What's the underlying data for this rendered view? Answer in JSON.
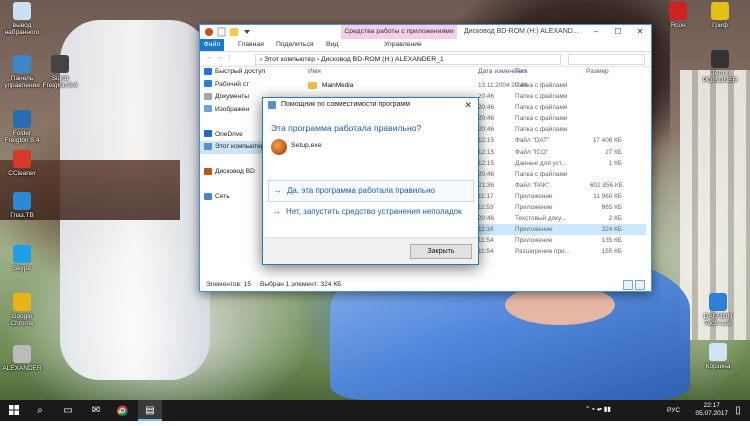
{
  "desktop": {
    "icons_left": [
      {
        "label": "вывод\nнабранного",
        "color": "#c8e0f0"
      },
      {
        "label": "Панель\nуправления",
        "color": "#3a86c8"
      },
      {
        "label": "Sigrid\nFreigton 8.4",
        "color": "#444444"
      },
      {
        "label": "Folder\nFreigton 8.4",
        "color": "#2b6cb0"
      },
      {
        "label": "CCleaner",
        "color": "#d43a2a"
      },
      {
        "label": "Глаз.ТВ",
        "color": "#2a8ad4"
      },
      {
        "label": "Skype",
        "color": "#1fa0e6"
      },
      {
        "label": "Google\nChrome",
        "color": "#e9b318"
      },
      {
        "label": "ALEXANDER",
        "color": "#bbbbbb"
      }
    ],
    "icons_right": [
      {
        "label": "Ясон",
        "color": "#d02020"
      },
      {
        "label": "Гриф",
        "color": "#e2c018"
      },
      {
        "label": "Terror\nPOISONER",
        "color": "#333333"
      },
      {
        "label": "DAEMON\nTools Lite",
        "color": "#2e7fd6"
      },
      {
        "label": "Корзина",
        "color": "#cfe4f5"
      }
    ]
  },
  "explorer": {
    "context_tab": "Средства работы с приложениями",
    "window_title": "Дисковод BD-ROM (H:) ALEXAND...",
    "ribbon_tabs": [
      "Файл",
      "Главная",
      "Поделиться",
      "Вид",
      "Управление"
    ],
    "breadcrumb": "›  Этот компьютер  ›  Дисковод BD-ROM (H:) ALEXANDER_1",
    "nav_items": [
      {
        "label": "Быстрый доступ",
        "color": "#1f78d1"
      },
      {
        "label": "Рабочий ст",
        "color": "#2b7cd3"
      },
      {
        "label": "Документы",
        "color": "#9aa9b6"
      },
      {
        "label": "Изображен",
        "color": "#6aa4d8"
      },
      {
        "label": "",
        "color": ""
      },
      {
        "label": "OneDrive",
        "color": "#1e6ec8"
      },
      {
        "label": "Этот компьютер",
        "color": "#5c8fc8"
      },
      {
        "label": "",
        "color": ""
      },
      {
        "label": "Дисковод BD",
        "color": "#c0521a"
      },
      {
        "label": "",
        "color": ""
      },
      {
        "label": "Сеть",
        "color": "#4a87c8"
      }
    ],
    "columns": {
      "name": "Имя",
      "date": "Дата изменения",
      "type": "Тип",
      "size": "Размер"
    },
    "files": [
      {
        "name": "MainMedia",
        "date": "13.11.2004 20:46",
        "type": "Папка с файлами",
        "size": ""
      },
      {
        "name": "",
        "date": "20:46",
        "type": "Папка с файлами",
        "size": ""
      },
      {
        "name": "",
        "date": "20:46",
        "type": "Папка с файлами",
        "size": ""
      },
      {
        "name": "",
        "date": "20:46",
        "type": "Папка с файлами",
        "size": ""
      },
      {
        "name": "",
        "date": "20:46",
        "type": "Папка с файлами",
        "size": ""
      },
      {
        "name": "",
        "date": "12:15",
        "type": "Файл \"DAT\"",
        "size": "17 408 КБ"
      },
      {
        "name": "",
        "date": "12:15",
        "type": "Файл \"ICO\"",
        "size": "27 КБ"
      },
      {
        "name": "",
        "date": "12:15",
        "type": "Данные для уст...",
        "size": "1 КБ"
      },
      {
        "name": "",
        "date": "20:46",
        "type": "Папка с файлами",
        "size": ""
      },
      {
        "name": "",
        "date": "21:36",
        "type": "Файл \"PAK\"",
        "size": "602 856 КБ"
      },
      {
        "name": "",
        "date": "11:17",
        "type": "Приложение",
        "size": "11 960 КБ"
      },
      {
        "name": "",
        "date": "11:53",
        "type": "Приложение",
        "size": "865 КБ"
      },
      {
        "name": "",
        "date": "20:46",
        "type": "Текстовый доку...",
        "size": "2 КБ"
      },
      {
        "name": "",
        "date": "11:16",
        "type": "Приложение",
        "size": "324 КБ",
        "selected": true
      },
      {
        "name": "",
        "date": "11:54",
        "type": "Приложение",
        "size": "135 КБ"
      },
      {
        "name": "",
        "date": "11:54",
        "type": "Расширение при...",
        "size": "155 КБ"
      }
    ],
    "status_count": "Элементов: 15",
    "status_selected": "Выбран 1 элемент: 324 КБ"
  },
  "dialog": {
    "title": "Помощник по совместимости программ",
    "close_glyph": "✕",
    "heading": "Эта программа работала правильно?",
    "program": "Setup.exe",
    "option_yes": "Да, эта программа работала правильно",
    "option_no": "Нет, запустить средство устранения неполадок",
    "arrow": "→",
    "close_button": "Закрыть"
  },
  "taskbar": {
    "lang": "РУС",
    "time": "22:17",
    "date": "05.07.2017"
  }
}
